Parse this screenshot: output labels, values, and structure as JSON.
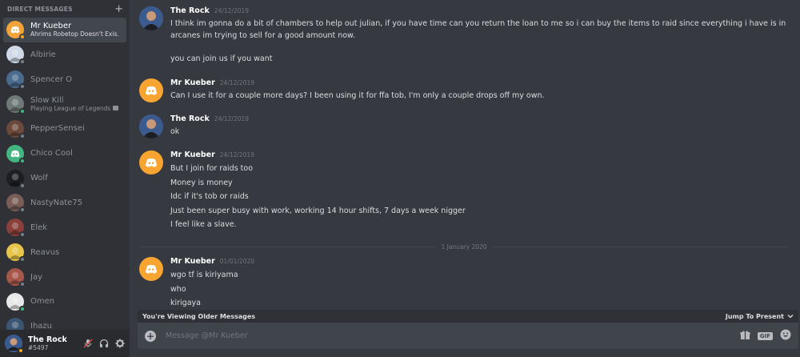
{
  "sidebar": {
    "header_label": "DIRECT MESSAGES",
    "add_symbol": "+",
    "items": [
      {
        "name": "Mr Kueber",
        "sub": "Ahrims Robetop Doesn't Exis...",
        "active": true,
        "status": "idle",
        "color": "#f2a33a"
      },
      {
        "name": "Albirie",
        "sub": "",
        "status": "offline",
        "color": "#cfd8e6"
      },
      {
        "name": "Spencer O",
        "sub": "",
        "status": "offline",
        "color": "#4a6b8e"
      },
      {
        "name": "Slow Kill",
        "sub": "Playing League of Legends",
        "status": "online",
        "color": "#6f7a78"
      },
      {
        "name": "PepperSensei",
        "sub": "",
        "status": "offline",
        "color": "#6b4a3b"
      },
      {
        "name": "Chico Cool",
        "sub": "",
        "status": "online",
        "color": "#43b581"
      },
      {
        "name": "Wolf",
        "sub": "",
        "status": "offline",
        "color": "#1d1e22"
      },
      {
        "name": "NastyNate75",
        "sub": "",
        "status": "offline",
        "color": "#7a5d57"
      },
      {
        "name": "Elek",
        "sub": "",
        "status": "offline",
        "color": "#8a3f3a"
      },
      {
        "name": "Reavus",
        "sub": "",
        "status": "offline",
        "color": "#e7c54a"
      },
      {
        "name": "Jay",
        "sub": "",
        "status": "offline",
        "color": "#a7574a"
      },
      {
        "name": "Omen",
        "sub": "",
        "status": "online",
        "color": "#e8e8e8"
      },
      {
        "name": "Ihazu",
        "sub": "",
        "status": "offline",
        "color": "#3b5672"
      }
    ]
  },
  "user_panel": {
    "name": "The Rock",
    "tag": "#5497"
  },
  "messages": [
    {
      "author": "The Rock",
      "time": "24/12/2019",
      "avatar": "rock",
      "lines": [
        "I think im gonna do a bit of chambers to help out julian, if you have time can you return the loan to me so i can buy the items to raid since everything i have is in",
        "arcanes im trying to sell for a good amount now.",
        "",
        "you can join us if you want"
      ]
    },
    {
      "author": "Mr Kueber",
      "time": "24/12/2019",
      "avatar": "discord",
      "lines": [
        "Can I use it for a couple more days? I been using it for ffa tob, I'm only a couple drops off my own."
      ]
    },
    {
      "author": "The Rock",
      "time": "24/12/2019",
      "avatar": "rock",
      "lines": [
        "ok"
      ]
    },
    {
      "author": "Mr Kueber",
      "time": "24/12/2019",
      "avatar": "discord",
      "lines": [
        "But I join for raids too",
        "Money is money",
        "Idc if it's tob or raids",
        "Just been super busy with work, working 14 hour shifts, 7 days a week nigger",
        "I feel like a slave."
      ]
    },
    {
      "author": "Mr Kueber",
      "time": "01/01/2020",
      "avatar": "discord",
      "lines": [
        "wgo tf is kiriyama",
        "who",
        "kirigaya"
      ]
    }
  ],
  "date_divider": "1 January 2020",
  "older_bar": {
    "text": "You're Viewing Older Messages",
    "jump": "Jump To Present"
  },
  "composer": {
    "placeholder": "Message @Mr Kueber",
    "gif_label": "GIF"
  },
  "colors": {
    "discord_orange": "#f7a530",
    "online": "#43b581",
    "idle": "#faa61a",
    "offline": "#747f8d"
  }
}
